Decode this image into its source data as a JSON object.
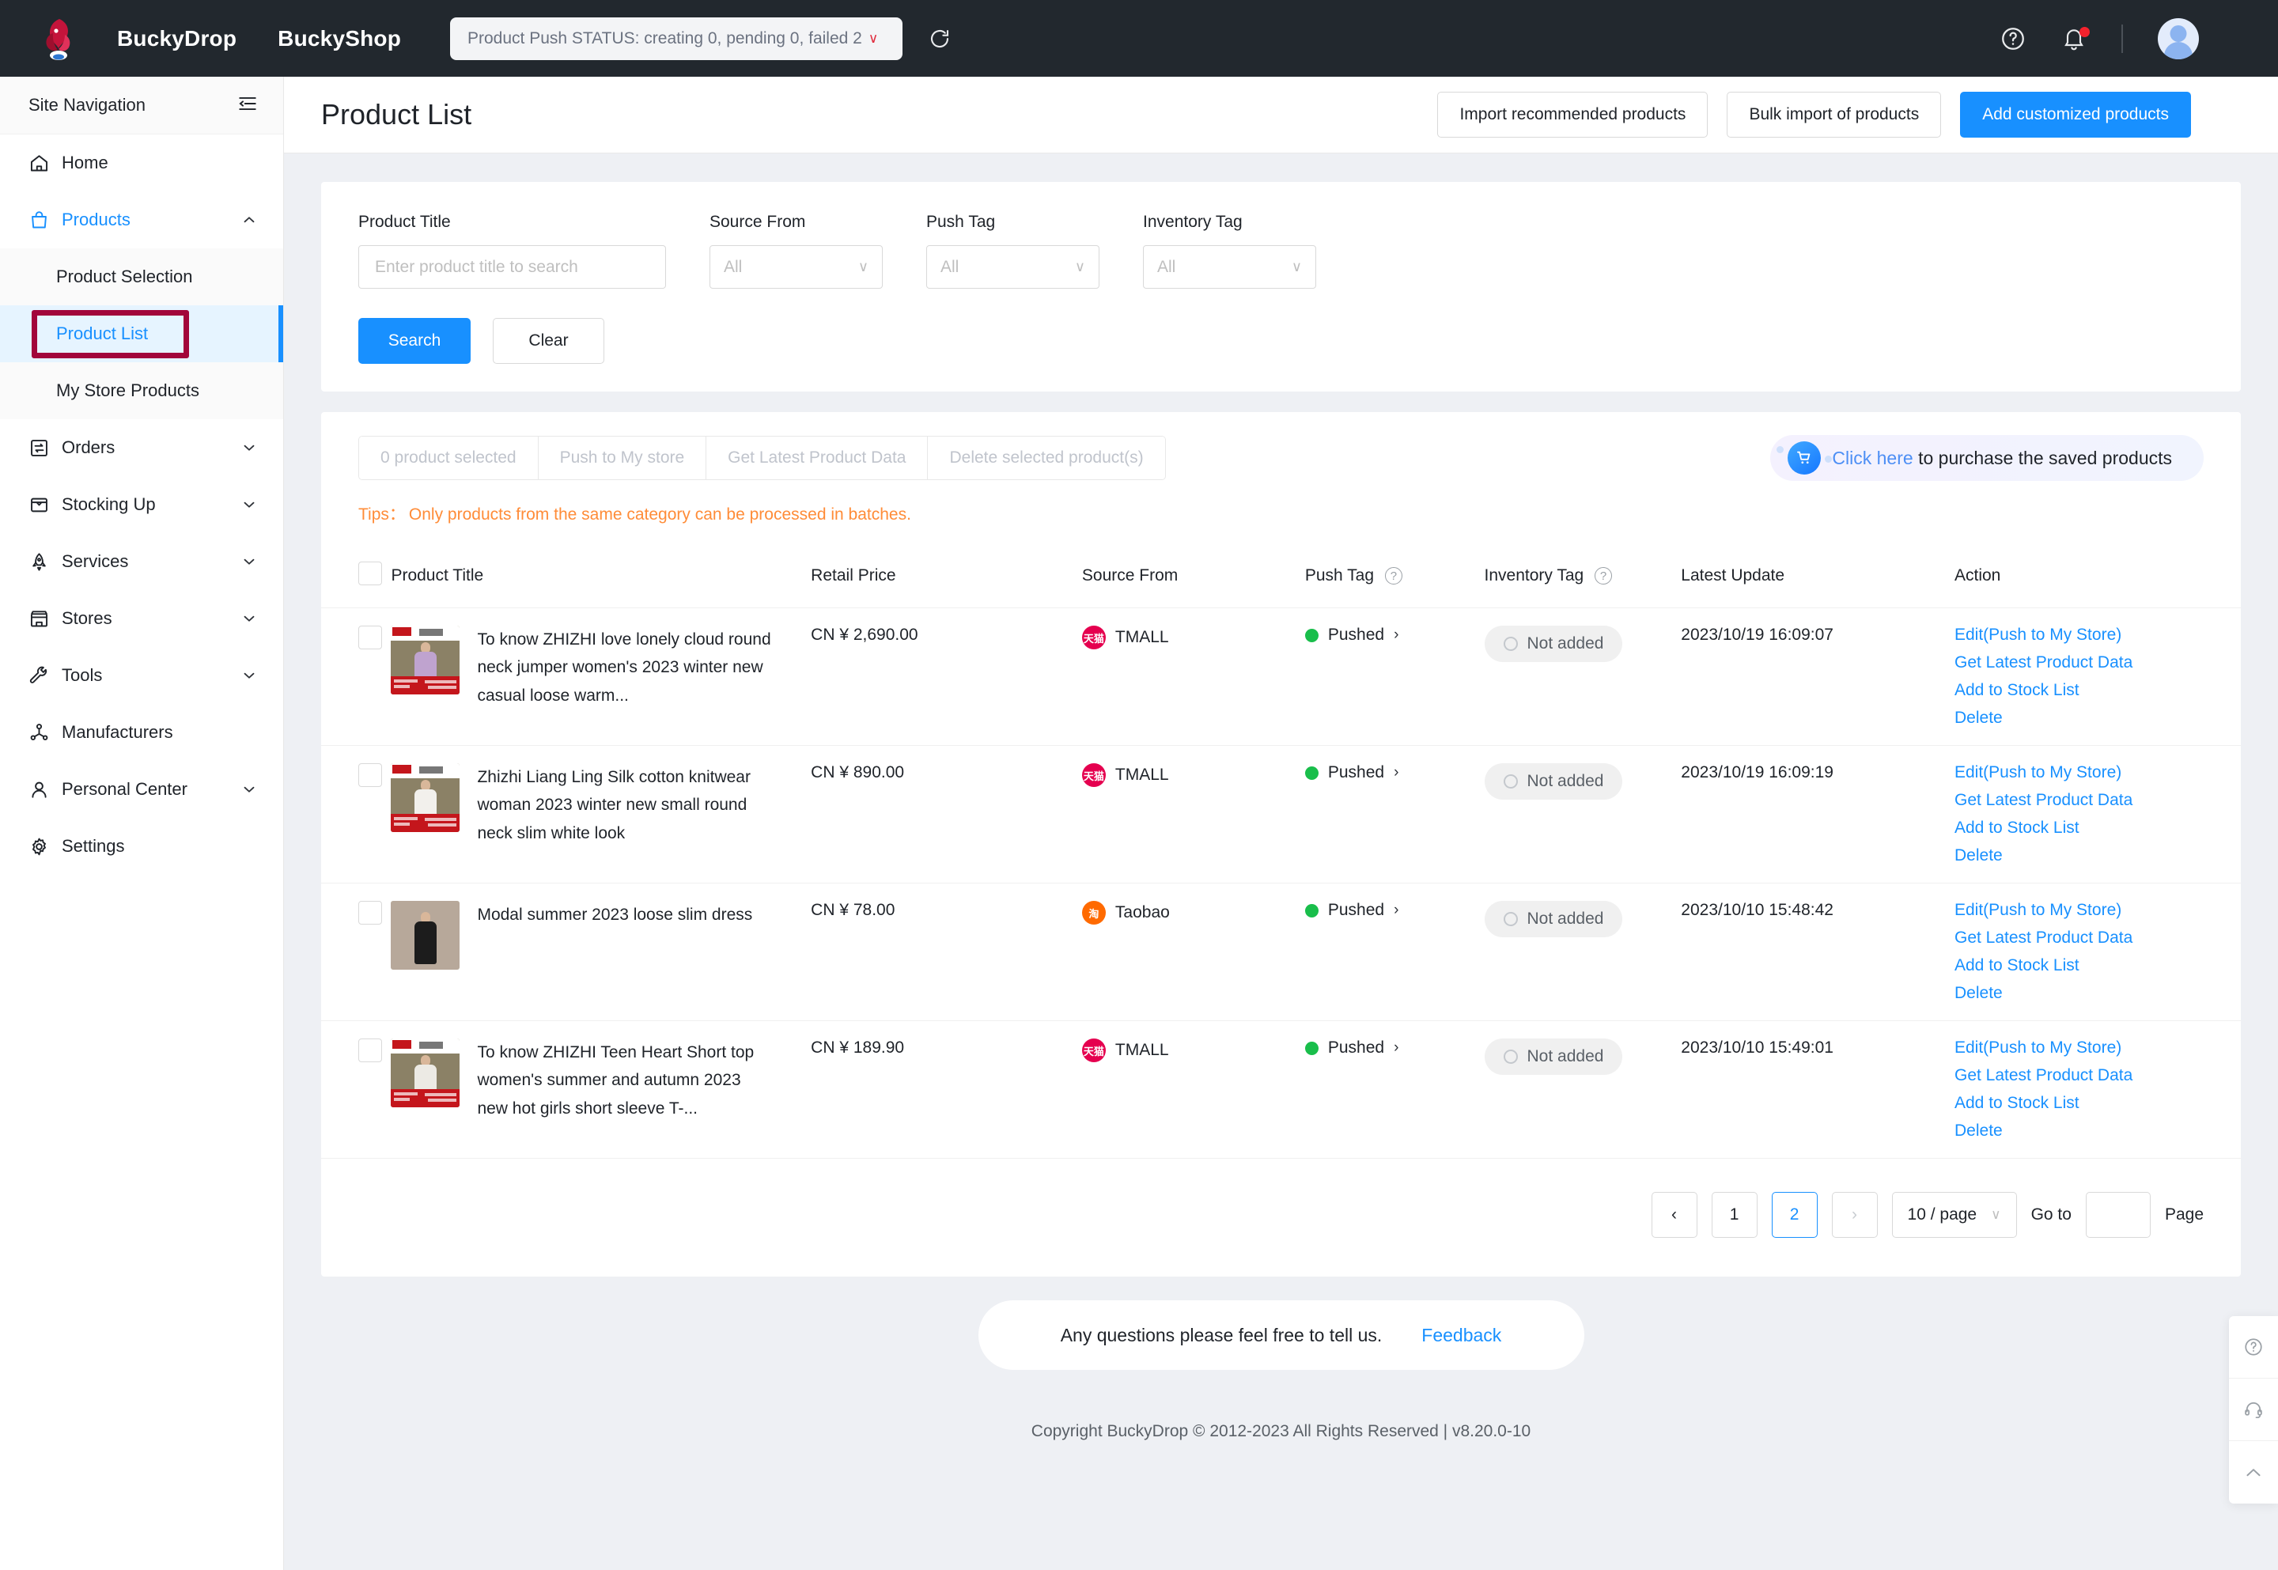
{
  "topbar": {
    "logo_icon": "buckydrop-dragon-logo",
    "brand_primary": "BuckyDrop",
    "brand_secondary": "BuckyShop",
    "push_status": "Product Push STATUS: creating 0, pending 0, failed 2",
    "push_status_caret": "∨",
    "refresh_icon": "refresh-icon",
    "help_icon": "help-circle-icon",
    "bell_icon": "bell-icon",
    "avatar_icon": "user-avatar"
  },
  "sidebar": {
    "title": "Site Navigation",
    "collapse_icon": "collapse-sidebar-icon",
    "items": [
      {
        "label": "Home",
        "icon": "home-icon",
        "arrow": "",
        "active": false
      },
      {
        "label": "Products",
        "icon": "bag-icon",
        "arrow": "∧",
        "active": true
      },
      {
        "label": "Orders",
        "icon": "orders-icon",
        "arrow": "∨",
        "active": false
      },
      {
        "label": "Stocking Up",
        "icon": "inbox-icon",
        "arrow": "∨",
        "active": false
      },
      {
        "label": "Services",
        "icon": "rocket-icon",
        "arrow": "∨",
        "active": false
      },
      {
        "label": "Stores",
        "icon": "store-icon",
        "arrow": "∨",
        "active": false
      },
      {
        "label": "Tools",
        "icon": "wrench-icon",
        "arrow": "∨",
        "active": false
      },
      {
        "label": "Manufacturers",
        "icon": "network-icon",
        "arrow": "",
        "active": false
      },
      {
        "label": "Personal Center",
        "icon": "person-icon",
        "arrow": "∨",
        "active": false
      },
      {
        "label": "Settings",
        "icon": "gear-icon",
        "arrow": "",
        "active": false
      }
    ],
    "submenu": [
      {
        "label": "Product Selection",
        "selected": false
      },
      {
        "label": "Product List",
        "selected": true
      },
      {
        "label": "My Store Products",
        "selected": false
      }
    ],
    "highlight_target": "Product List"
  },
  "page": {
    "title": "Product List",
    "actions": [
      {
        "label": "Import recommended products",
        "style": "default"
      },
      {
        "label": "Bulk import of products",
        "style": "default"
      },
      {
        "label": "Add customized products",
        "style": "primary"
      }
    ]
  },
  "filters": {
    "product_title": {
      "label": "Product Title",
      "placeholder": "Enter product title to search",
      "value": ""
    },
    "source_from": {
      "label": "Source From",
      "value": "All"
    },
    "push_tag": {
      "label": "Push Tag",
      "value": "All"
    },
    "inventory_tag": {
      "label": "Inventory Tag",
      "value": "All"
    },
    "search_label": "Search",
    "clear_label": "Clear",
    "select_arrow": "∨"
  },
  "bulk": {
    "selected_label": "0 product selected",
    "push_label": "Push to My store",
    "get_latest_label": "Get Latest Product Data",
    "delete_label": "Delete selected product(s)"
  },
  "promo": {
    "cart_icon": "shopping-cart-icon",
    "link_text": "Click here",
    "rest_text": " to purchase the saved products"
  },
  "tips": {
    "keyword": "Tips：",
    "text": "Only products from the same category can be processed in batches."
  },
  "table": {
    "headers": {
      "product_title": "Product Title",
      "retail_price": "Retail Price",
      "source_from": "Source From",
      "push_tag": "Push Tag",
      "inventory_tag": "Inventory Tag",
      "latest_update": "Latest Update",
      "action": "Action"
    },
    "help_icon": "question-circle-icon",
    "action_links": [
      "Edit(Push to My Store)",
      "Get Latest Product Data",
      "Add to Stock List",
      "Delete"
    ],
    "rows": [
      {
        "title": "To know ZHIZHI love lonely cloud round neck jumper women's 2023 winter new casual loose warm...",
        "thumb": "product-thumbnail-purple-jumper",
        "price": "CN ¥ 2,690.00",
        "source": "TMALL",
        "source_badge": "天猫",
        "push_tag": "Pushed",
        "inventory_tag": "Not added",
        "latest_update": "2023/10/19 16:09:07"
      },
      {
        "title": "Zhizhi Liang Ling Silk cotton knitwear woman 2023 winter new small round neck slim white look",
        "thumb": "product-thumbnail-white-dress",
        "price": "CN ¥ 890.00",
        "source": "TMALL",
        "source_badge": "天猫",
        "push_tag": "Pushed",
        "inventory_tag": "Not added",
        "latest_update": "2023/10/19 16:09:19"
      },
      {
        "title": "Modal summer 2023 loose slim dress",
        "thumb": "product-thumbnail-black-dress",
        "price": "CN ¥ 78.00",
        "source": "Taobao",
        "source_badge": "淘",
        "push_tag": "Pushed",
        "inventory_tag": "Not added",
        "latest_update": "2023/10/10 15:48:42"
      },
      {
        "title": "To know ZHIZHI Teen Heart Short top women's summer and autumn 2023 new hot girls short sleeve T-...",
        "thumb": "product-thumbnail-white-top",
        "price": "CN ¥ 189.90",
        "source": "TMALL",
        "source_badge": "天猫",
        "push_tag": "Pushed",
        "inventory_tag": "Not added",
        "latest_update": "2023/10/10 15:49:01"
      }
    ]
  },
  "pagination": {
    "prev": "‹",
    "next": "›",
    "pages": [
      "1",
      "2"
    ],
    "current": "2",
    "page_size": "10 / page",
    "size_arrow": "∨",
    "goto_label": "Go to",
    "goto_value": "",
    "page_label": "Page"
  },
  "footer": {
    "feedback_text": "Any questions please feel free to tell us.",
    "feedback_link": "Feedback",
    "copyright": "Copyright BuckyDrop © 2012-2023 All Rights Reserved | v8.20.0-10"
  },
  "floatbar": [
    {
      "icon": "help-circle-icon"
    },
    {
      "icon": "headset-icon"
    },
    {
      "icon": "back-to-top-icon"
    }
  ],
  "colors": {
    "primary": "#1890ff",
    "topbar_bg": "#22282e",
    "tips": "#ff8c38",
    "highlight_box": "#a2063a",
    "pushed_dot": "#19be4b",
    "tmall": "#e5004f",
    "taobao": "#ff6a00"
  }
}
